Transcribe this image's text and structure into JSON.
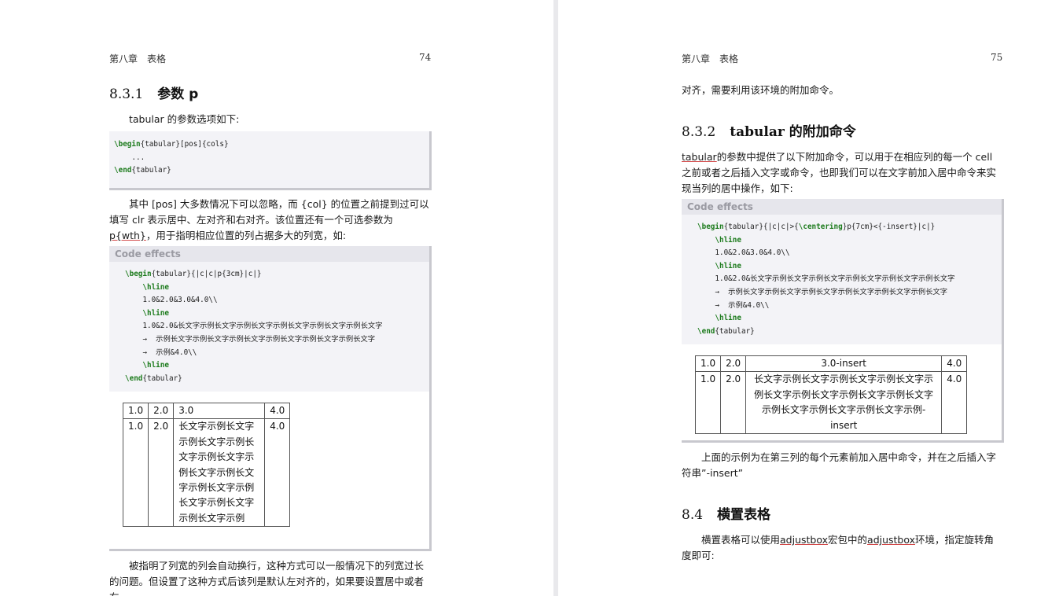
{
  "left": {
    "header_chapter": "第八章　表格",
    "page_number": "74",
    "section_num": "8.3.1",
    "section_title": "参数 p",
    "intro": "tabular 的参数选项如下:",
    "code1": [
      "\\begin{tabular}[pos]{cols}",
      "    ...",
      "\\end{tabular}"
    ],
    "para2_a": "其中 [pos] 大多数情况下可以忽略，而 {col} 的位置之前提到过可以填写 clr 表示居中、左对齐和右对齐。该位置还有一个可选参数为",
    "para2_link": "p{wth}",
    "para2_b": "，用于指明相应位置的列占据多大的列宽，如:",
    "effects_title": "Code effects",
    "effects_code": [
      "\\begin{tabular}{|c|c|p{3cm}|c|}",
      "    \\hline",
      "    1.0&2.0&3.0&4.0\\\\",
      "    \\hline",
      "    1.0&2.0&长文字示例长文字示例长文字示例长文字示例长文字示例长文字",
      "    →  示例长文字示例长文字示例长文字示例长文字示例长文字示例长文字",
      "    →  示例&4.0\\\\",
      "    \\hline",
      "\\end{tabular}"
    ],
    "table": {
      "row1": [
        "1.0",
        "2.0",
        "3.0",
        "4.0"
      ],
      "row2": [
        "1.0",
        "2.0",
        "长文字示例长文字示例长文字示例长文字示例长文字示例长文字示例长文字示例长文字示例长文字示例长文字示例长文字示例",
        "4.0"
      ]
    },
    "para3": "被指明了列宽的列会自动换行，这种方式可以一般情况下的列宽过长的问题。但设置了这种方式后该列是默认左对齐的，如果要设置居中或者右"
  },
  "right": {
    "header_chapter": "第八章　表格",
    "page_number": "75",
    "cont": "对齐，需要利用该环境的附加命令。",
    "section1_num": "8.3.2",
    "section1_title_a": "tabular",
    "section1_title_b": " 的附加命令",
    "para1_link": "tabular",
    "para1_rest": "的参数中提供了以下附加命令，可以用于在相应列的每一个 cell 之前或者之后插入文字或命令，也即我们可以在文字前加入居中命令来实现当列的居中操作，如下:",
    "effects_title": "Code effects",
    "effects_code": [
      "\\begin{tabular}{|c|c|>{\\centering}p{7cm}<{-insert}|c|}",
      "    \\hline",
      "    1.0&2.0&3.0&4.0\\\\",
      "    \\hline",
      "    1.0&2.0&长文字示例长文字示例长文字示例长文字示例长文字示例长文字",
      "    →  示例长文字示例长文字示例长文字示例长文字示例长文字示例长文字",
      "    →  示例&4.0\\\\",
      "    \\hline",
      "\\end{tabular}"
    ],
    "table": {
      "row1": [
        "1.0",
        "2.0",
        "3.0-insert",
        "4.0"
      ],
      "row2": [
        "1.0",
        "2.0",
        "长文字示例长文字示例长文字示例长文字示例长文字示例长文字示例长文字示例长文字示例长文字示例长文字示例长文字示例-insert",
        "4.0"
      ]
    },
    "para2": "上面的示例为在第三列的每个元素前加入居中命令，并在之后插入字符串”-insert”",
    "section2_num": "8.4",
    "section2_title": "横置表格",
    "para3_a": "横置表格可以使用",
    "para3_link1": "adjustbox",
    "para3_b": "宏包中的",
    "para3_link2": "adjustbox",
    "para3_c": "环境，指定旋转角度即可:"
  }
}
